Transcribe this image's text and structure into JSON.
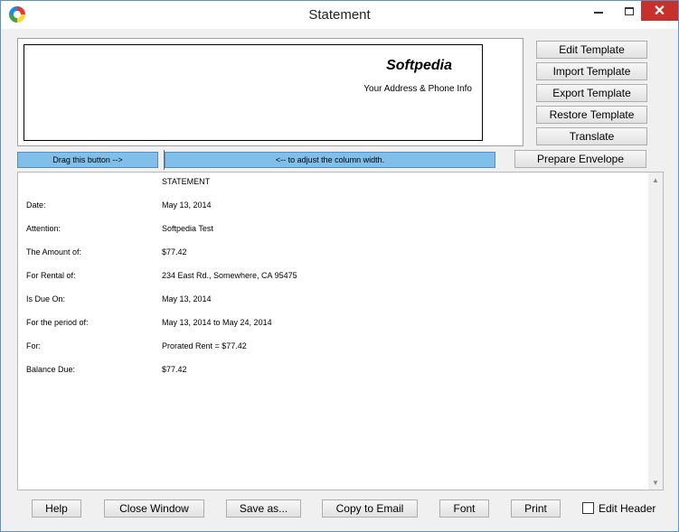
{
  "window": {
    "title": "Statement"
  },
  "header": {
    "company": "Softpedia",
    "address": "Your Address & Phone Info"
  },
  "side_buttons": {
    "edit_template": "Edit Template",
    "import_template": "Import Template",
    "export_template": "Export Template",
    "restore_template": "Restore Template",
    "translate": "Translate",
    "prepare_envelope": "Prepare Envelope"
  },
  "drag": {
    "left_label": "Drag this button -->",
    "right_label": "<-- to adjust the column width."
  },
  "statement": {
    "heading": "STATEMENT",
    "rows": [
      {
        "label": "Date:",
        "value": "May 13, 2014"
      },
      {
        "label": "Attention:",
        "value": "Softpedia Test"
      },
      {
        "label": "The Amount of:",
        "value": "$77.42"
      },
      {
        "label": "For Rental of:",
        "value": "234 East Rd., Somewhere, CA 95475"
      },
      {
        "label": "Is Due On:",
        "value": "May 13, 2014"
      },
      {
        "label": "For the period of:",
        "value": "May 13, 2014 to May 24, 2014"
      },
      {
        "label": "For:",
        "value": "Prorated Rent = $77.42"
      },
      {
        "label": "Balance Due:",
        "value": "$77.42"
      }
    ]
  },
  "bottom_buttons": {
    "help": "Help",
    "close_window": "Close Window",
    "save_as": "Save as...",
    "copy_to_email": "Copy to Email",
    "font": "Font",
    "print": "Print"
  },
  "edit_header": {
    "label": "Edit Header",
    "checked": false
  },
  "icons": {
    "app": "app-icon",
    "minimize": "minimize-icon",
    "maximize": "maximize-icon",
    "close": "close-icon",
    "scroll_up": "scroll-up-arrow-icon",
    "scroll_down": "scroll-down-arrow-icon"
  },
  "colors": {
    "drag_bar": "#7fbfea",
    "close_button": "#c7312b"
  }
}
